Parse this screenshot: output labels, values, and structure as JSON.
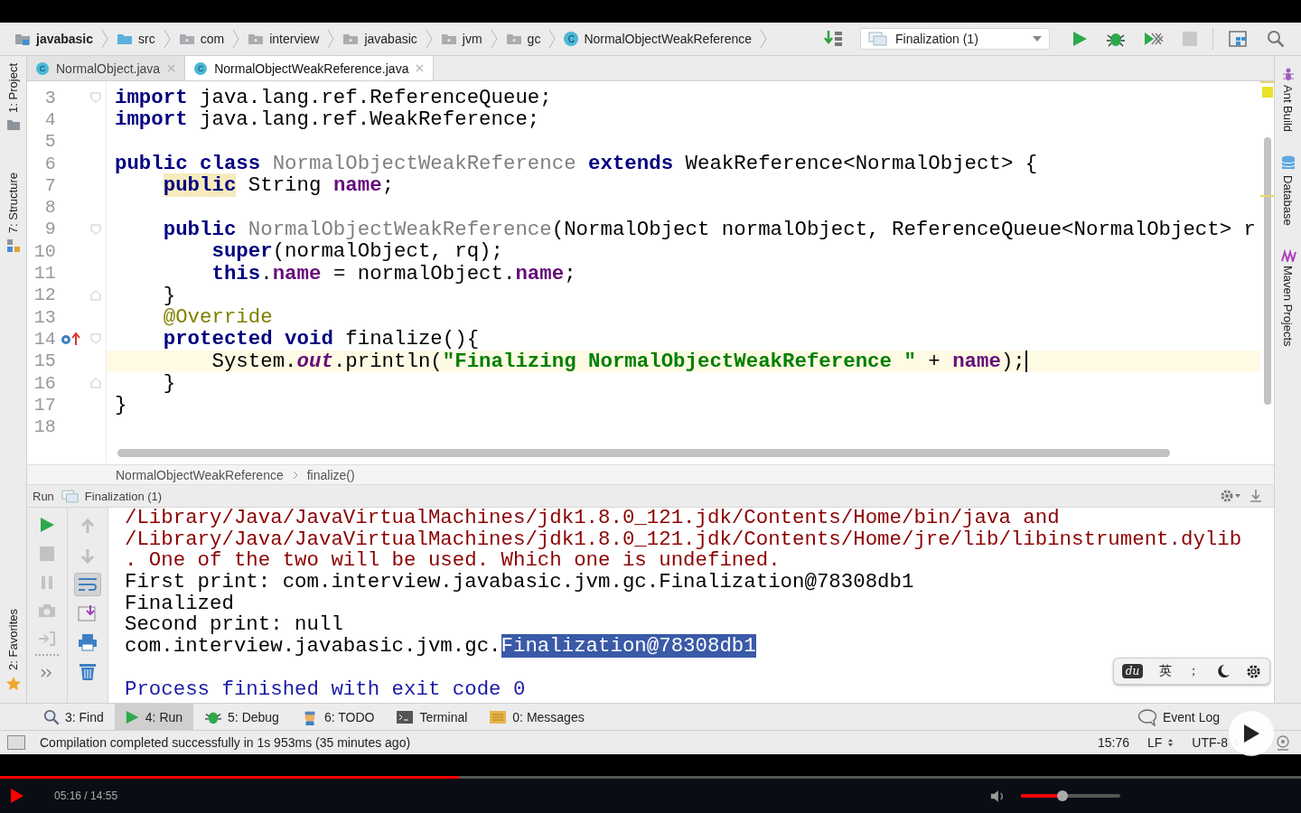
{
  "navigation_bar": {
    "breadcrumbs": [
      {
        "label": "javabasic",
        "kind": "module"
      },
      {
        "label": "src",
        "kind": "source"
      },
      {
        "label": "com",
        "kind": "package"
      },
      {
        "label": "interview",
        "kind": "package"
      },
      {
        "label": "javabasic",
        "kind": "package"
      },
      {
        "label": "jvm",
        "kind": "package"
      },
      {
        "label": "gc",
        "kind": "package"
      },
      {
        "label": "NormalObjectWeakReference",
        "kind": "class",
        "icon_letter": "C"
      }
    ],
    "run_configuration": "Finalization (1)"
  },
  "left_strip": [
    {
      "label": "1: Project",
      "kind": "project"
    },
    {
      "label": "7: Structure",
      "kind": "structure"
    },
    {
      "label": "2: Favorites",
      "kind": "favorites"
    }
  ],
  "right_strip": [
    {
      "label": "Ant Build",
      "kind": "ant"
    },
    {
      "label": "Database",
      "kind": "database"
    },
    {
      "label": "Maven Projects",
      "kind": "maven"
    }
  ],
  "editor_tabs": [
    {
      "label": "NormalObject.java",
      "icon_letter": "C",
      "selected": false
    },
    {
      "label": "NormalObjectWeakReference.java",
      "icon_letter": "C",
      "selected": true
    }
  ],
  "editor": {
    "lines": [
      {
        "number": "3",
        "fold_start": true,
        "tokens": [
          {
            "text": "import",
            "kind": "keyword"
          },
          {
            "text": " java.lang.ref.ReferenceQueue;",
            "kind": "plain"
          }
        ]
      },
      {
        "number": "4",
        "tokens": [
          {
            "text": "import",
            "kind": "keyword"
          },
          {
            "text": " java.lang.ref.WeakReference;",
            "kind": "plain"
          }
        ]
      },
      {
        "number": "5"
      },
      {
        "number": "6",
        "tokens": [
          {
            "text": "public class",
            "kind": "keyword"
          },
          {
            "text": " NormalObjectWeakReference",
            "kind": "unused"
          },
          {
            "text": " extends",
            "kind": "keyword"
          },
          {
            "text": " WeakReference<NormalObject> {",
            "kind": "plain"
          }
        ]
      },
      {
        "number": "7",
        "tokens": [
          {
            "text": "    public",
            "kind": "keyword_warning"
          },
          {
            "text": " String ",
            "kind": "plain"
          },
          {
            "text": "name",
            "kind": "field"
          },
          {
            "text": ";",
            "kind": "plain"
          }
        ]
      },
      {
        "number": "8"
      },
      {
        "number": "9",
        "fold_start": true,
        "tokens": [
          {
            "text": "    public",
            "kind": "keyword"
          },
          {
            "text": " NormalObjectWeakReference",
            "kind": "unused"
          },
          {
            "text": "(NormalObject normalObject, ReferenceQueue<NormalObject> r",
            "kind": "plain"
          }
        ]
      },
      {
        "number": "10",
        "tokens": [
          {
            "text": "        super",
            "kind": "keyword"
          },
          {
            "text": "(normalObject, rq);",
            "kind": "plain"
          }
        ]
      },
      {
        "number": "11",
        "tokens": [
          {
            "text": "        this",
            "kind": "keyword"
          },
          {
            "text": ".",
            "kind": "plain"
          },
          {
            "text": "name",
            "kind": "field"
          },
          {
            "text": " = normalObject.",
            "kind": "plain"
          },
          {
            "text": "name",
            "kind": "field"
          },
          {
            "text": ";",
            "kind": "plain"
          }
        ]
      },
      {
        "number": "12",
        "fold_end": true,
        "tokens": [
          {
            "text": "    }",
            "kind": "plain"
          }
        ]
      },
      {
        "number": "13",
        "tokens": [
          {
            "text": "    @Override",
            "kind": "annotation"
          }
        ]
      },
      {
        "number": "14",
        "fold_start": true,
        "overrides": true,
        "tokens": [
          {
            "text": "    protected void",
            "kind": "keyword"
          },
          {
            "text": " finalize(){",
            "kind": "plain"
          }
        ]
      },
      {
        "number": "15",
        "current": true,
        "tokens": [
          {
            "text": "        System.",
            "kind": "plain"
          },
          {
            "text": "out",
            "kind": "static"
          },
          {
            "text": ".println(",
            "kind": "plain"
          },
          {
            "text": "\"Finalizing NormalObjectWeakReference \"",
            "kind": "string"
          },
          {
            "text": " + ",
            "kind": "plain"
          },
          {
            "text": "name",
            "kind": "field"
          },
          {
            "text": ");",
            "kind": "plain"
          }
        ]
      },
      {
        "number": "16",
        "fold_end": true,
        "tokens": [
          {
            "text": "    }",
            "kind": "plain"
          }
        ]
      },
      {
        "number": "17",
        "tokens": [
          {
            "text": "}",
            "kind": "plain"
          }
        ]
      },
      {
        "number": "18"
      }
    ]
  },
  "editor_breadcrumbs": [
    "NormalObjectWeakReference",
    "finalize()"
  ],
  "run_panel": {
    "title": "Run",
    "configuration": "Finalization (1)",
    "toolbar_left": [
      {
        "kind": "rerun",
        "disabled": false
      },
      {
        "kind": "stop",
        "disabled": true
      },
      {
        "kind": "pause",
        "disabled": true
      },
      {
        "kind": "camera",
        "disabled": true
      },
      {
        "kind": "exit",
        "disabled": true
      }
    ],
    "toolbar_right": [
      {
        "kind": "up",
        "disabled": true
      },
      {
        "kind": "down",
        "disabled": true
      },
      {
        "kind": "wrap",
        "disabled": false,
        "selected": true
      },
      {
        "kind": "scroll",
        "disabled": false,
        "selected": false
      },
      {
        "kind": "print",
        "disabled": false,
        "selected": false
      },
      {
        "kind": "trash",
        "disabled": false,
        "selected": false
      }
    ],
    "console": [
      {
        "kind": "error",
        "segments": [
          {
            "text": "/Library/Java/JavaVirtualMachines/jdk1.8.0_121.jdk/Contents/Home/bin/java and",
            "selected": false
          }
        ]
      },
      {
        "kind": "error",
        "segments": [
          {
            "text": "/Library/Java/JavaVirtualMachines/jdk1.8.0_121.jdk/Contents/Home/jre/lib/libinstrument.dylib",
            "selected": false
          }
        ]
      },
      {
        "kind": "error",
        "segments": [
          {
            "text": ". One of the two will be used. Which one is undefined.",
            "selected": false
          }
        ]
      },
      {
        "kind": "output",
        "segments": [
          {
            "text": "First print: com.interview.javabasic.jvm.gc.Finalization@78308db1",
            "selected": false
          }
        ]
      },
      {
        "kind": "output",
        "segments": [
          {
            "text": "Finalized",
            "selected": false
          }
        ]
      },
      {
        "kind": "output",
        "segments": [
          {
            "text": "Second print: null",
            "selected": false
          }
        ]
      },
      {
        "kind": "output",
        "segments": [
          {
            "text": "com.interview.javabasic.jvm.gc.",
            "selected": false
          },
          {
            "text": "Finalization@78308db1",
            "selected": true
          }
        ]
      },
      {
        "kind": "blank"
      },
      {
        "kind": "system",
        "segments": [
          {
            "text": "Process finished with exit code 0",
            "selected": false
          }
        ]
      }
    ]
  },
  "input_method_bar": {
    "logo": "du",
    "language": "英",
    "punctuation": "；"
  },
  "tool_windows": [
    {
      "label": "3: Find",
      "kind": "find",
      "selected": false
    },
    {
      "label": "4: Run",
      "kind": "run",
      "selected": true
    },
    {
      "label": "5: Debug",
      "kind": "debug",
      "selected": false
    },
    {
      "label": "6: TODO",
      "kind": "todo",
      "selected": false
    },
    {
      "label": "Terminal",
      "kind": "terminal",
      "selected": false
    },
    {
      "label": "0: Messages",
      "kind": "messages",
      "selected": false
    }
  ],
  "event_log": "Event Log",
  "status_bar": {
    "message": "Compilation completed successfully in 1s 953ms (35 minutes ago)",
    "position": "15:76",
    "line_separator": "LF",
    "encoding": "UTF-8"
  },
  "video_player": {
    "paused": true,
    "time": "05:16 / 14:55",
    "progress": {
      "level": 0.353
    },
    "volume": {
      "level": 0.42
    }
  }
}
